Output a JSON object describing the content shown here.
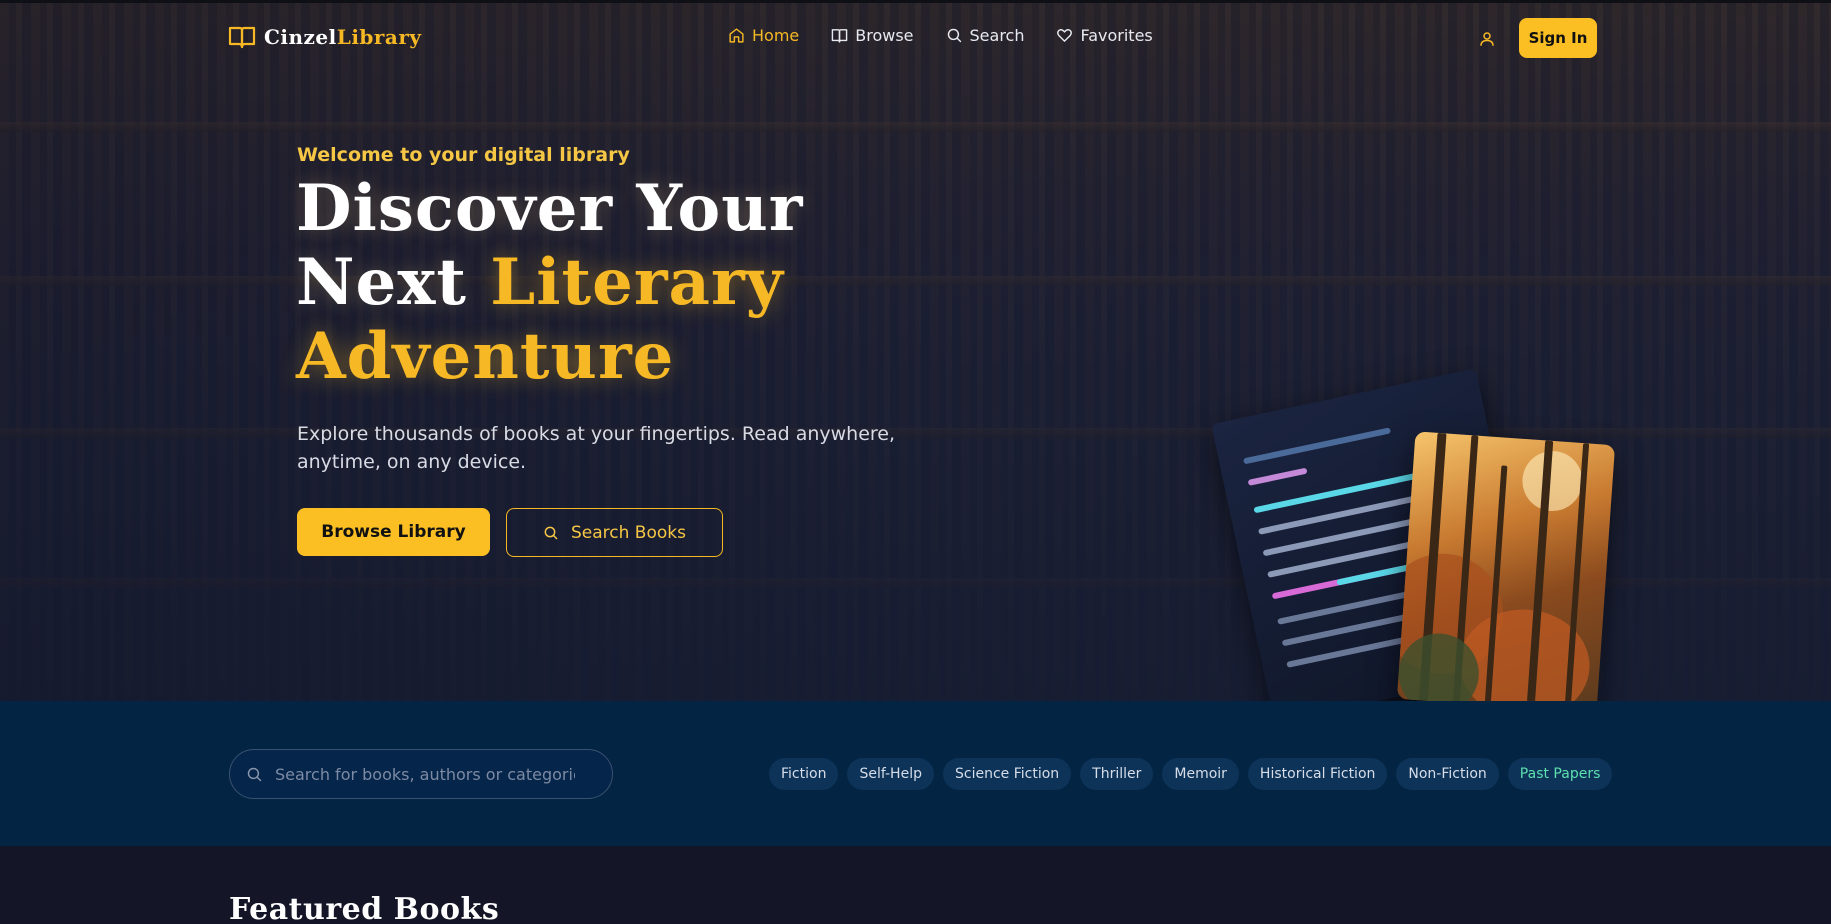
{
  "brand": {
    "name_part1": "Cinzel",
    "name_part2": "Library",
    "accent_color": "#f6b824"
  },
  "nav": {
    "items": [
      {
        "label": "Home",
        "icon": "home-icon",
        "active": true
      },
      {
        "label": "Browse",
        "icon": "book-open-icon",
        "active": false
      },
      {
        "label": "Search",
        "icon": "search-icon",
        "active": false
      },
      {
        "label": "Favorites",
        "icon": "heart-icon",
        "active": false
      }
    ],
    "user_icon": "user-icon",
    "signin_label": "Sign In"
  },
  "hero": {
    "welcome": "Welcome to your digital library",
    "headline_white": "Discover Your Next",
    "headline_gold": "Literary Adventure",
    "subtitle": "Explore thousands of books at your fingertips. Read anywhere, anytime, on any device.",
    "primary_button": "Browse Library",
    "secondary_button": "Search Books"
  },
  "search": {
    "placeholder": "Search for books, authors or categories"
  },
  "categories": [
    "Fiction",
    "Self-Help",
    "Science Fiction",
    "Thriller",
    "Memoir",
    "Historical Fiction",
    "Non-Fiction",
    "Past Papers"
  ],
  "featured": {
    "title": "Featured Books"
  },
  "colors": {
    "gold": "#fbbf24",
    "strip_bg": "#032443",
    "chip_bg": "#0d3358",
    "highlight_chip": "#5ee0b0"
  }
}
